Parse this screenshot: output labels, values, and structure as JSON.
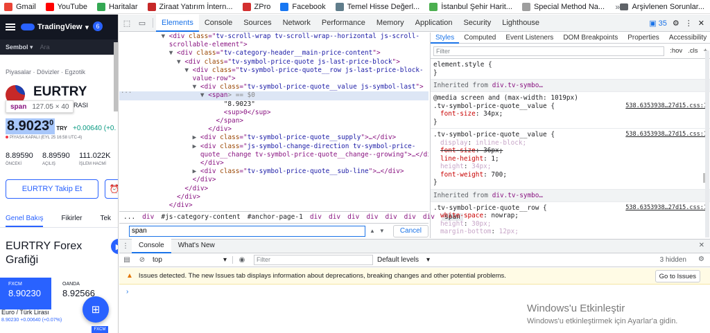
{
  "bookmarks": [
    {
      "label": "Gmail",
      "color": "#ea4335"
    },
    {
      "label": "YouTube",
      "color": "#ff0000"
    },
    {
      "label": "Haritalar",
      "color": "#34a853"
    },
    {
      "label": "Ziraat Yatırım İntern...",
      "color": "#c62828"
    },
    {
      "label": "ZPro",
      "color": "#d32f2f"
    },
    {
      "label": "Facebook",
      "color": "#1877f2"
    },
    {
      "label": "Temel Hisse Değerl...",
      "color": "#607d8b"
    },
    {
      "label": "İstanbul Şehir Harit...",
      "color": "#4caf50"
    },
    {
      "label": "Special Method Na...",
      "color": "#9e9e9e"
    }
  ],
  "bookmarks_more": "»",
  "bookmarks_archive": "Arşivlenen Sorunlar...",
  "tv": {
    "logo": "TradingView",
    "logo_caret": "▾",
    "avatar": "6",
    "search_chip": "Sembol",
    "search_chip_caret": "▾",
    "search_placeholder": "Ara",
    "breadcrumb": "Piyasalar · Dövizler · Egzotik",
    "symbol": "EURTRY",
    "subtitle": "K LİRASI",
    "tooltip_tag": "span",
    "tooltip_dims": "127.05 × 40",
    "price_main": "8.9023",
    "price_sup": "0",
    "price_currency": "TRY",
    "change": "+0.00640 (+0.",
    "market_status": "PİYASA KAPALI (EYL 25 16:58 UTC-4)",
    "stats": [
      {
        "value": "8.89590",
        "label": "ÖNCEKİ"
      },
      {
        "value": "8.89590",
        "label": "AÇILIŞ"
      },
      {
        "value": "111.022K",
        "label": "İŞLEM HACMİ"
      }
    ],
    "follow_button": "EURTRY Takip Et",
    "alarm_icon": "⏰",
    "tabs": [
      "Genel Bakış",
      "Fikirler",
      "Tek"
    ],
    "section_title": "EURTRY Forex Grafiği",
    "section_btn": "▶",
    "card1": {
      "symbol": "FXCM",
      "value": "8.90230"
    },
    "card2": {
      "symbol": "OANDA",
      "value": "8.92566"
    },
    "mini_title": "Euro / Türk Lirası",
    "mini_price": "8.90230 +0.00640 (+0.07%)",
    "fab_icon": "⊞",
    "fxcm_tag": "FXCM"
  },
  "devtools": {
    "tabs": [
      "Elements",
      "Console",
      "Sources",
      "Network",
      "Performance",
      "Memory",
      "Application",
      "Security",
      "Lighthouse"
    ],
    "active_tab": "Elements",
    "issue_count": "35",
    "dom_lines": [
      {
        "indent": 10,
        "arrow": "▼",
        "tag": "div",
        "cls": "tv-scroll-wrap tv-scroll-wrap--horizontal js-scroll-",
        "tail": ""
      },
      {
        "indent": 10,
        "arrow": "",
        "tag": "",
        "cls": "",
        "tail": "scrollable-element\">",
        "raw": true
      },
      {
        "indent": 12,
        "arrow": "▼",
        "tag": "div",
        "cls": "tv-category-header__main-price-content",
        "tail": ">"
      },
      {
        "indent": 14,
        "arrow": "▼",
        "tag": "div",
        "cls": "tv-symbol-price-quote js-last-price-block",
        "tail": ">"
      },
      {
        "indent": 16,
        "arrow": "▼",
        "tag": "div",
        "cls": "tv-symbol-price-quote__row js-last-price-block-",
        "tail": ""
      },
      {
        "indent": 16,
        "arrow": "",
        "tag": "",
        "cls": "",
        "tail": "value-row\">",
        "raw": true
      },
      {
        "indent": 18,
        "arrow": "▼",
        "tag": "div",
        "cls": "tv-symbol-price-quote__value js-symbol-last",
        "tail": ">"
      },
      {
        "indent": 20,
        "arrow": "▼",
        "tag": "span",
        "cls": "",
        "tail": "> == $0",
        "selected": true
      },
      {
        "indent": 24,
        "arrow": "",
        "tag": "",
        "cls": "",
        "tail": "\"8.9023\"",
        "text": true
      },
      {
        "indent": 24,
        "arrow": "",
        "tag": "",
        "cls": "",
        "tail": "<sup>0</sup>",
        "raw": true
      },
      {
        "indent": 22,
        "arrow": "",
        "tag": "",
        "cls": "",
        "tail": "</span>",
        "raw": true
      },
      {
        "indent": 20,
        "arrow": "",
        "tag": "",
        "cls": "",
        "tail": "</div>",
        "raw": true
      },
      {
        "indent": 18,
        "arrow": "▶",
        "tag": "div",
        "cls": "tv-symbol-price-quote__supply",
        "tail": ">…</div>"
      },
      {
        "indent": 18,
        "arrow": "▶",
        "tag": "div",
        "cls": "js-symbol-change-direction tv-symbol-price-",
        "tail": ""
      },
      {
        "indent": 18,
        "arrow": "",
        "tag": "",
        "cls": "",
        "tail": "quote__change tv-symbol-price-quote__change--growing\">…</div>",
        "raw": true
      },
      {
        "indent": 18,
        "arrow": "",
        "tag": "",
        "cls": "",
        "tail": "</div>",
        "raw": true
      },
      {
        "indent": 18,
        "arrow": "▶",
        "tag": "div",
        "cls": "tv-symbol-price-quote__sub-line",
        "tail": ">…</div>"
      },
      {
        "indent": 16,
        "arrow": "",
        "tag": "",
        "cls": "",
        "tail": "</div>",
        "raw": true
      },
      {
        "indent": 14,
        "arrow": "",
        "tag": "",
        "cls": "",
        "tail": "</div>",
        "raw": true
      },
      {
        "indent": 12,
        "arrow": "",
        "tag": "",
        "cls": "",
        "tail": "</div>",
        "raw": true
      },
      {
        "indent": 10,
        "arrow": "",
        "tag": "",
        "cls": "",
        "tail": "</div>",
        "raw": true
      }
    ],
    "ellipsis": "...",
    "crumbs": [
      "...",
      "div",
      "#js-category-content",
      "#anchor-page-1",
      "div",
      "div",
      "div",
      "div",
      "div",
      "div",
      "div",
      "span"
    ],
    "search_value": "span",
    "cancel_label": "Cancel",
    "styles_tabs": [
      "Styles",
      "Computed",
      "Event Listeners",
      "DOM Breakpoints",
      "Properties",
      "Accessibility"
    ],
    "styles_filter_placeholder": "Filter",
    "styles_hov": ":hov",
    "styles_cls": ".cls",
    "styles_add": "+",
    "element_style": "element.style {",
    "inherited1_prefix": "Inherited from",
    "inherited1_link": "div.tv-symbo…",
    "media": "@media screen and (max-width: 1019px)",
    "rule1": {
      "selector": ".tv-symbol-price-quote__value {",
      "source": "538.6353938…27d15.css:1",
      "props": [
        {
          "n": "font-size",
          "v": "34px;"
        }
      ]
    },
    "rule2": {
      "selector": ".tv-symbol-price-quote__value {",
      "source": "538.6353938…27d15.css:1",
      "props": [
        {
          "n": "display",
          "v": "inline-block;",
          "dim": true
        },
        {
          "n": "font-size",
          "v": "36px;",
          "strike": true
        },
        {
          "n": "line-height",
          "v": "1;"
        },
        {
          "n": "height",
          "v": "34px;",
          "dim": true
        },
        {
          "n": "font-weight",
          "v": "700;"
        }
      ]
    },
    "inherited2_prefix": "Inherited from",
    "inherited2_link": "div.tv-symbo…",
    "rule3": {
      "selector": ".tv-symbol-price-quote__row {",
      "source": "538.6353938…27d15.css:1",
      "props": [
        {
          "n": "white-space",
          "v": "nowrap;"
        },
        {
          "n": "height",
          "v": "30px;",
          "dim": true
        },
        {
          "n": "margin-bottom",
          "v": "12px;",
          "dim": true
        }
      ]
    },
    "close_brace": "}",
    "drawer_tabs": [
      "Console",
      "What's New"
    ],
    "context": "top",
    "console_filter": "Filter",
    "levels": "Default levels",
    "hidden": "3 hidden",
    "issues_text": "Issues detected. The new Issues tab displays information about deprecations, breaking changes and other potential problems.",
    "issues_button": "Go to Issues",
    "prompt": "›"
  },
  "windows": {
    "line1": "Windows'u Etkinleştir",
    "line2": "Windows'u etkinleştirmek için Ayarlar'a gidin."
  }
}
